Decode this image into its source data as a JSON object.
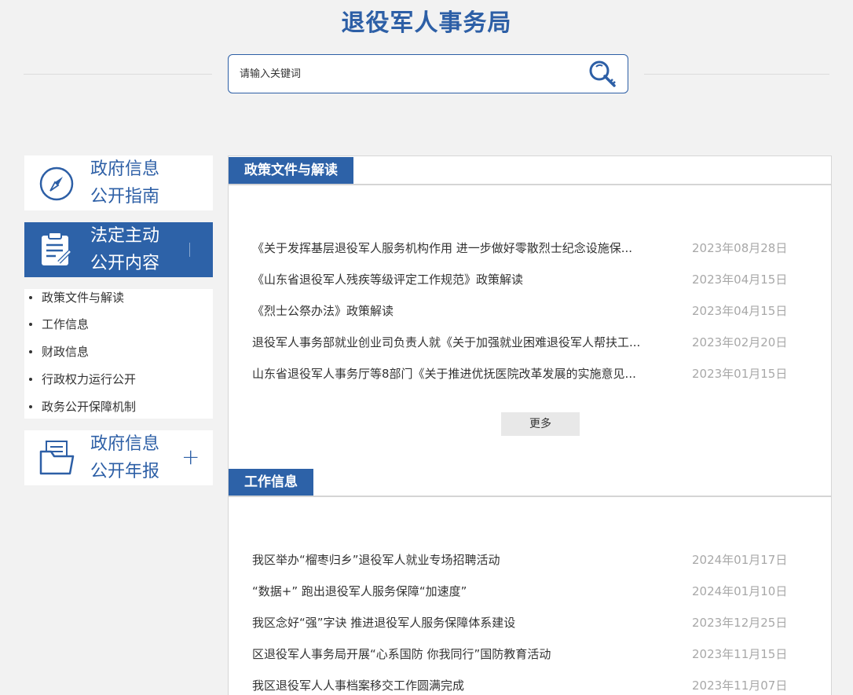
{
  "header": {
    "title": "退役军人事务局"
  },
  "search": {
    "placeholder": "请输入关键词"
  },
  "sidebar": {
    "guide": {
      "line1": "政府信息",
      "line2": "公开指南"
    },
    "law": {
      "line1": "法定主动",
      "line2": "公开内容"
    },
    "submenu": [
      "政策文件与解读",
      "工作信息",
      "财政信息",
      "行政权力运行公开",
      "政务公开保障机制"
    ],
    "report": {
      "line1": "政府信息",
      "line2": "公开年报",
      "plus": "+"
    }
  },
  "sections": {
    "policy": {
      "title": "政策文件与解读",
      "more_label": "更多",
      "items": [
        {
          "title": "《关于发挥基层退役军人服务机构作用 进一步做好零散烈士纪念设施保...",
          "date": "2023年08月28日"
        },
        {
          "title": "《山东省退役军人残疾等级评定工作规范》政策解读",
          "date": "2023年04月15日"
        },
        {
          "title": "《烈士公祭办法》政策解读",
          "date": "2023年04月15日"
        },
        {
          "title": "退役军人事务部就业创业司负责人就《关于加强就业困难退役军人帮扶工...",
          "date": "2023年02月20日"
        },
        {
          "title": "山东省退役军人事务厅等8部门《关于推进优抚医院改革发展的实施意见...",
          "date": "2023年01月15日"
        }
      ]
    },
    "work": {
      "title": "工作信息",
      "items": [
        {
          "title": "我区举办“榴枣归乡”退役军人就业专场招聘活动",
          "date": "2024年01月17日"
        },
        {
          "title": "“数据+”  跑出退役军人服务保障“加速度”",
          "date": "2024年01月10日"
        },
        {
          "title": "我区念好“强”字诀  推进退役军人服务保障体系建设",
          "date": "2023年12月25日"
        },
        {
          "title": "区退役军人事务局开展“心系国防 你我同行”国防教育活动",
          "date": "2023年11月15日"
        },
        {
          "title": "我区退役军人人事档案移交工作圆满完成",
          "date": "2023年11月07日"
        }
      ]
    }
  },
  "colors": {
    "brand": "#2d62a8",
    "title": "#2d5fa6",
    "date": "#a8a8a8"
  },
  "icons": {
    "search": "search-key-icon",
    "guide": "compass-icon",
    "law": "clipboard-pen-icon",
    "report": "folder-document-icon"
  }
}
